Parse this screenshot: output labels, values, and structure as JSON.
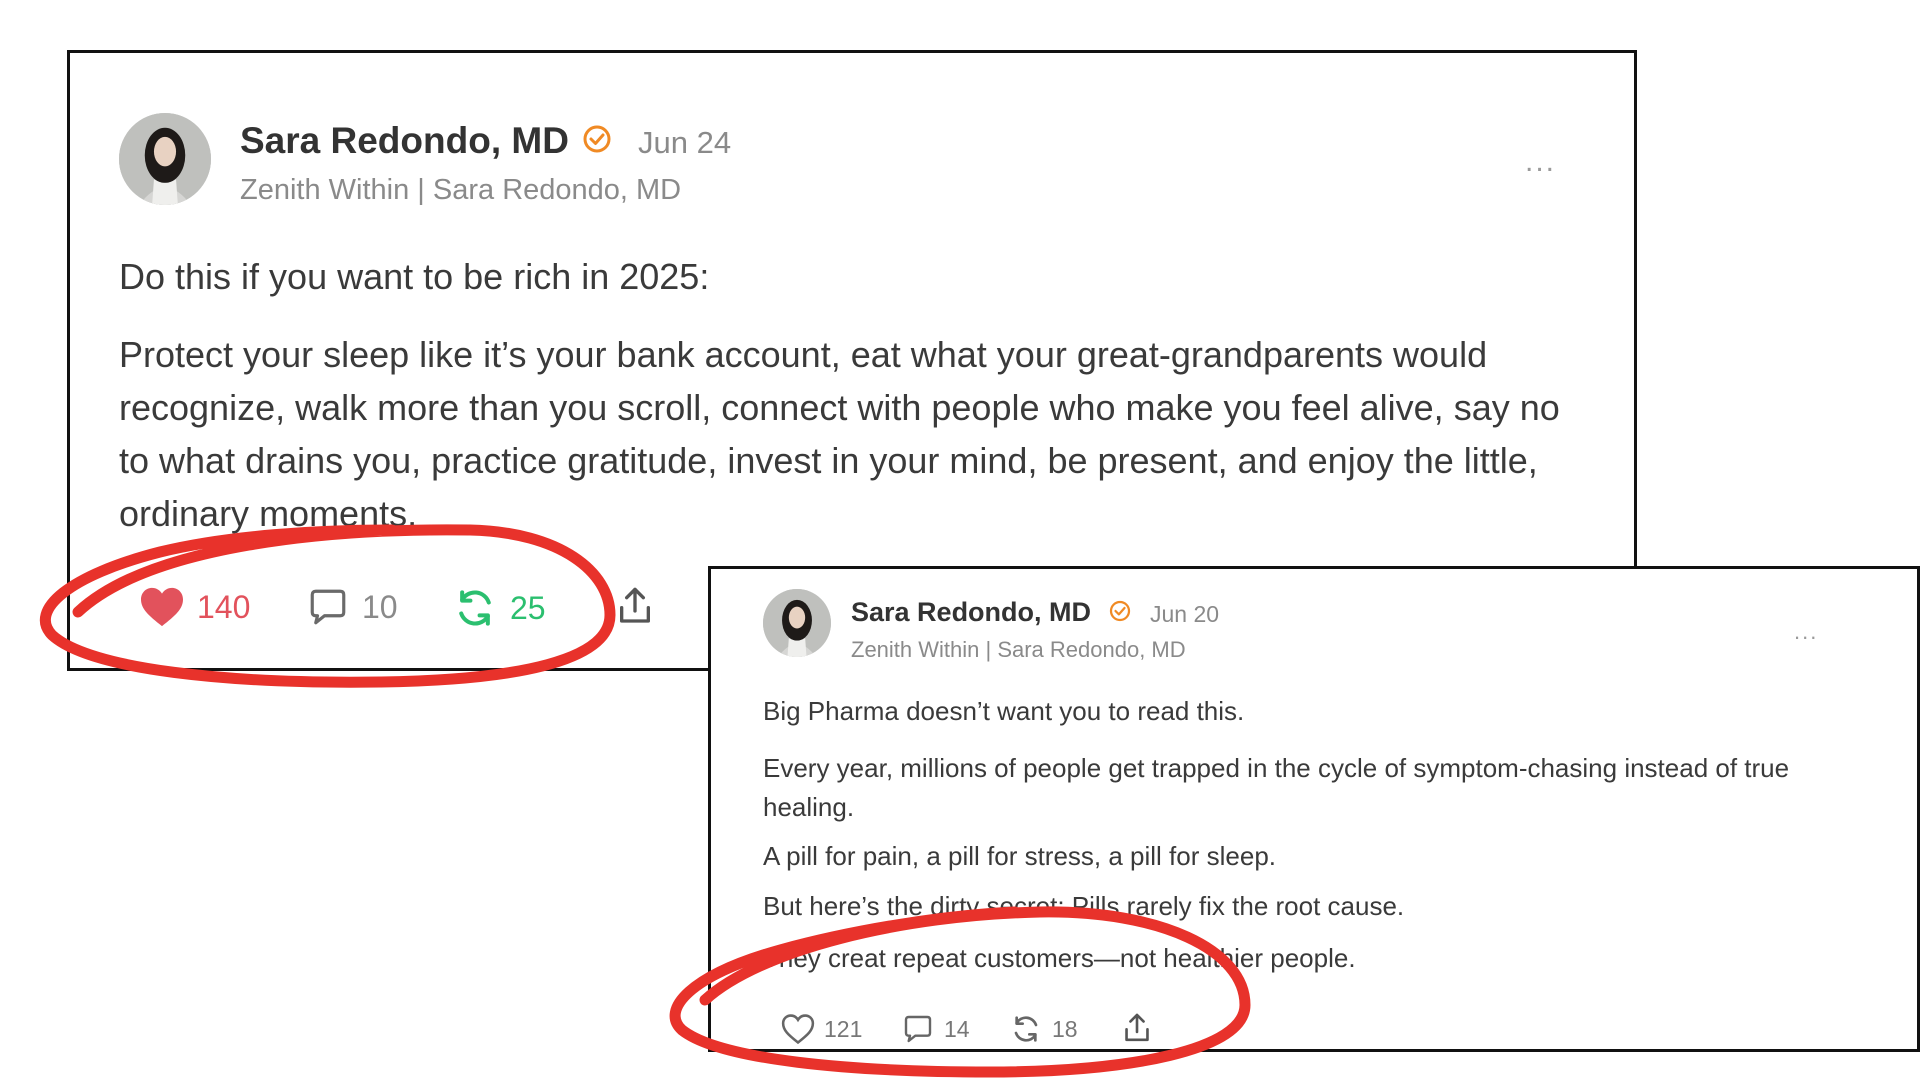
{
  "posts": [
    {
      "author": "Sara Redondo, MD",
      "date": "Jun 24",
      "publication": "Zenith Within | Sara Redondo, MD",
      "more_label": "...",
      "paragraphs": [
        "Do this if you want to be rich in 2025:",
        "Protect your sleep like it’s your bank account, eat what your great-grandparents would recognize, walk more than you scroll, connect with people who make you feel alive, say no to what drains you, practice gratitude, invest in your mind, be present, and enjoy the little, ordinary moments."
      ],
      "likes": "140",
      "comments": "10",
      "restacks": "25",
      "liked": true
    },
    {
      "author": "Sara Redondo, MD",
      "date": "Jun 20",
      "publication": "Zenith Within | Sara Redondo, MD",
      "more_label": "...",
      "paragraphs": [
        "Big Pharma doesn’t want you to read this.",
        "Every year, millions of people get trapped in the cycle of symptom-chasing instead of true healing.",
        "A pill for pain, a pill for stress, a pill for sleep.",
        "But here’s the dirty secret: Pills rarely fix the root cause.",
        "They creat repeat customers—not healthier people."
      ],
      "likes": "121",
      "comments": "14",
      "restacks": "18",
      "liked": false
    }
  ],
  "colors": {
    "like_active": "#e2525c",
    "restack_active": "#2bbf6f",
    "verified_badge": "#f08a24",
    "annotation": "#e8322b"
  },
  "icons": [
    "heart-icon",
    "comment-icon",
    "restack-icon",
    "share-icon",
    "verified-icon",
    "more-icon"
  ]
}
